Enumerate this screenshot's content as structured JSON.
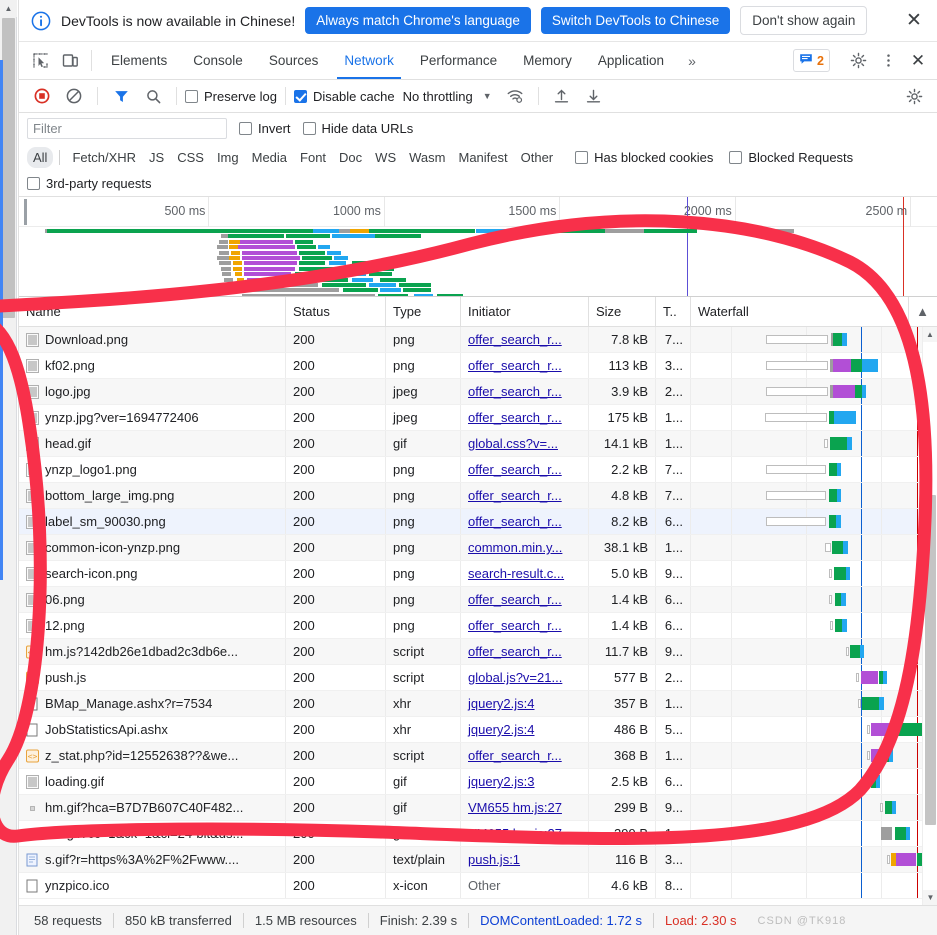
{
  "infobar": {
    "message": "DevTools is now available in Chinese!",
    "info_icon": "info-circle-icon",
    "buttons": [
      {
        "label": "Always match Chrome's language",
        "style": "primary"
      },
      {
        "label": "Switch DevTools to Chinese",
        "style": "primary"
      },
      {
        "label": "Don't show again",
        "style": "plain"
      }
    ],
    "close_icon": "close-icon"
  },
  "tabstrip": {
    "inspect_icon": "inspect-element-icon",
    "device_icon": "device-toolbar-icon",
    "tabs": [
      {
        "label": "Elements",
        "active": false
      },
      {
        "label": "Console",
        "active": false
      },
      {
        "label": "Sources",
        "active": false
      },
      {
        "label": "Network",
        "active": true
      },
      {
        "label": "Performance",
        "active": false
      },
      {
        "label": "Memory",
        "active": false
      },
      {
        "label": "Application",
        "active": false
      }
    ],
    "more_tabs_icon": "chevron-double-right-icon",
    "issues_icon": "issues-message-icon",
    "issues_count": "2",
    "settings_icon": "gear-icon",
    "kebab_icon": "more-vertical-icon",
    "close_icon": "close-icon"
  },
  "nettoolbar": {
    "record_icon": "record-stop-icon",
    "clear_icon": "clear-no-entry-icon",
    "filter_icon": "funnel-filter-icon",
    "search_icon": "search-icon",
    "preserve_log": {
      "label": "Preserve log",
      "checked": false
    },
    "disable_cache": {
      "label": "Disable cache",
      "checked": true
    },
    "throttling": {
      "value": "No throttling",
      "caret_icon": "chevron-down-icon"
    },
    "wifi_icon": "network-conditions-wifi-icon",
    "import_icon": "import-har-upload-icon",
    "export_icon": "export-har-download-icon",
    "settings_icon": "gear-icon"
  },
  "filterrow": {
    "placeholder": "Filter",
    "value": "",
    "invert": {
      "label": "Invert",
      "checked": false
    },
    "hide_data_urls": {
      "label": "Hide data URLs",
      "checked": false
    }
  },
  "typerow": {
    "chips": [
      "All",
      "Fetch/XHR",
      "JS",
      "CSS",
      "Img",
      "Media",
      "Font",
      "Doc",
      "WS",
      "Wasm",
      "Manifest",
      "Other"
    ],
    "selected": "All",
    "has_blocked_cookies": {
      "label": "Has blocked cookies",
      "checked": false
    },
    "blocked_requests": {
      "label": "Blocked Requests",
      "checked": false
    },
    "third_party": {
      "label": "3rd-party requests",
      "checked": false
    }
  },
  "overview": {
    "ticks": [
      "500 ms",
      "1000 ms",
      "1500 ms",
      "2000 ms",
      "2500 m"
    ],
    "dcl_line_color": "#5c4fd6",
    "load_line_color": "#d93025"
  },
  "table": {
    "columns": [
      "Name",
      "Status",
      "Type",
      "Initiator",
      "Size",
      "T..",
      "Waterfall"
    ],
    "sort_icon": "sort-ascending-triangle-icon",
    "rows": [
      {
        "name": "Download.png",
        "icon": "image-thumb-icon",
        "status": "200",
        "type": "png",
        "initiator": "offer_search_r...",
        "initiator_link": true,
        "size": "7.8 kB",
        "time": "7..."
      },
      {
        "name": "kf02.png",
        "icon": "image-thumb-icon",
        "status": "200",
        "type": "png",
        "initiator": "offer_search_r...",
        "initiator_link": true,
        "size": "113 kB",
        "time": "3..."
      },
      {
        "name": "logo.jpg",
        "icon": "image-thumb-icon",
        "status": "200",
        "type": "jpeg",
        "initiator": "offer_search_r...",
        "initiator_link": true,
        "size": "3.9 kB",
        "time": "2..."
      },
      {
        "name": "ynzp.jpg?ver=1694772406",
        "icon": "image-thumb-icon",
        "status": "200",
        "type": "jpeg",
        "initiator": "offer_search_r...",
        "initiator_link": true,
        "size": "175 kB",
        "time": "1..."
      },
      {
        "name": "head.gif",
        "icon": "image-thumb-icon",
        "status": "200",
        "type": "gif",
        "initiator": "global.css?v=...",
        "initiator_link": true,
        "size": "14.1 kB",
        "time": "1..."
      },
      {
        "name": "ynzp_logo1.png",
        "icon": "image-thumb-icon",
        "status": "200",
        "type": "png",
        "initiator": "offer_search_r...",
        "initiator_link": true,
        "size": "2.2 kB",
        "time": "7..."
      },
      {
        "name": "bottom_large_img.png",
        "icon": "image-thumb-icon",
        "status": "200",
        "type": "png",
        "initiator": "offer_search_r...",
        "initiator_link": true,
        "size": "4.8 kB",
        "time": "7..."
      },
      {
        "name": "label_sm_90030.png",
        "icon": "image-thumb-icon",
        "status": "200",
        "type": "png",
        "initiator": "offer_search_r...",
        "initiator_link": true,
        "size": "8.2 kB",
        "time": "6..."
      },
      {
        "name": "common-icon-ynzp.png",
        "icon": "image-thumb-icon",
        "status": "200",
        "type": "png",
        "initiator": "common.min.y...",
        "initiator_link": true,
        "size": "38.1 kB",
        "time": "1..."
      },
      {
        "name": "search-icon.png",
        "icon": "image-thumb-icon",
        "status": "200",
        "type": "png",
        "initiator": "search-result.c...",
        "initiator_link": true,
        "size": "5.0 kB",
        "time": "9..."
      },
      {
        "name": "06.png",
        "icon": "image-thumb-icon",
        "status": "200",
        "type": "png",
        "initiator": "offer_search_r...",
        "initiator_link": true,
        "size": "1.4 kB",
        "time": "6..."
      },
      {
        "name": "12.png",
        "icon": "image-thumb-icon",
        "status": "200",
        "type": "png",
        "initiator": "offer_search_r...",
        "initiator_link": true,
        "size": "1.4 kB",
        "time": "6..."
      },
      {
        "name": "hm.js?142db26e1dbad2c3db6e...",
        "icon": "script-icon",
        "status": "200",
        "type": "script",
        "initiator": "offer_search_r...",
        "initiator_link": true,
        "size": "11.7 kB",
        "time": "9..."
      },
      {
        "name": "push.js",
        "icon": "script-icon",
        "status": "200",
        "type": "script",
        "initiator": "global.js?v=21...",
        "initiator_link": true,
        "size": "577 B",
        "time": "2..."
      },
      {
        "name": "BMap_Manage.ashx?r=7534",
        "icon": "doc-icon",
        "status": "200",
        "type": "xhr",
        "initiator": "jquery2.js:4",
        "initiator_link": true,
        "size": "357 B",
        "time": "1..."
      },
      {
        "name": "JobStatisticsApi.ashx",
        "icon": "doc-icon",
        "status": "200",
        "type": "xhr",
        "initiator": "jquery2.js:4",
        "initiator_link": true,
        "size": "486 B",
        "time": "5..."
      },
      {
        "name": "z_stat.php?id=12552638??&we...",
        "icon": "script-icon",
        "status": "200",
        "type": "script",
        "initiator": "offer_search_r...",
        "initiator_link": true,
        "size": "368 B",
        "time": "1..."
      },
      {
        "name": "loading.gif",
        "icon": "image-thumb-icon",
        "status": "200",
        "type": "gif",
        "initiator": "jquery2.js:3",
        "initiator_link": true,
        "size": "2.5 kB",
        "time": "6..."
      },
      {
        "name": "hm.gif?hca=B7D7B607C40F482...",
        "icon": "tiny-image-icon",
        "status": "200",
        "type": "gif",
        "initiator": "VM655 hm.js:27",
        "initiator_link": true,
        "size": "299 B",
        "time": "9..."
      },
      {
        "name": "hm.gif?cc=1&ck=1&cl=24-bit&ds...",
        "icon": "tiny-image-icon",
        "status": "200",
        "type": "gif",
        "initiator": "VM655 hm.js:27",
        "initiator_link": true,
        "size": "299 B",
        "time": "1..."
      },
      {
        "name": "s.gif?r=https%3A%2F%2Fwww....",
        "icon": "doc-text-icon",
        "status": "200",
        "type": "text/plain",
        "initiator": "push.js:1",
        "initiator_link": true,
        "size": "116 B",
        "time": "3..."
      },
      {
        "name": "ynzpico.ico",
        "icon": "doc-icon",
        "status": "200",
        "type": "x-icon",
        "initiator": "Other",
        "initiator_link": false,
        "size": "4.6 kB",
        "time": "8..."
      }
    ]
  },
  "statusbar": {
    "requests": "58 requests",
    "transferred": "850 kB transferred",
    "resources": "1.5 MB resources",
    "finish": "Finish: 2.39 s",
    "dom_content_loaded": "DOMContentLoaded: 1.72 s",
    "load": "Load: 2.30 s",
    "watermark": "CSDN @TK918"
  },
  "annotation": {
    "color": "#f8304a",
    "shape": "hand-drawn-red-ellipse-highlight"
  }
}
